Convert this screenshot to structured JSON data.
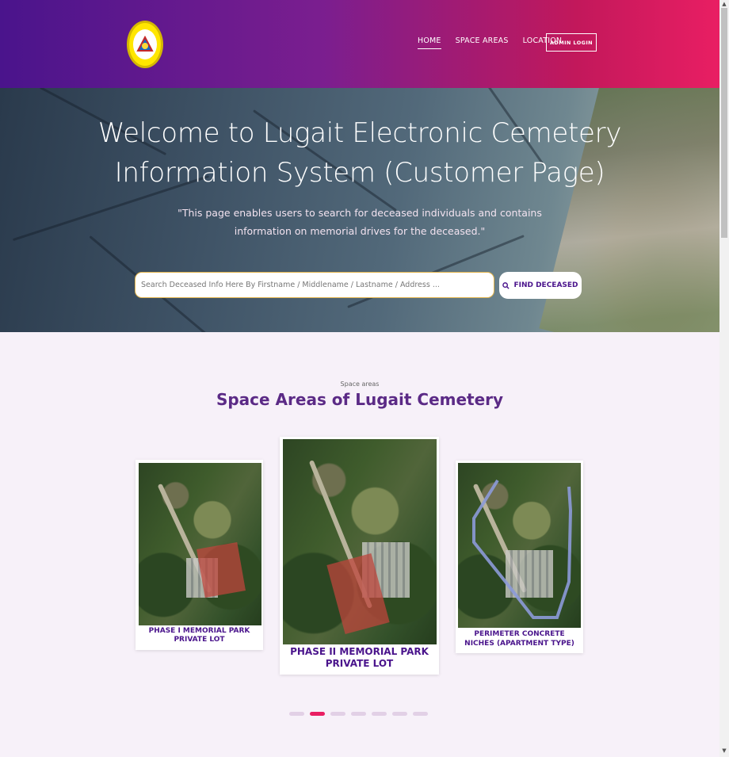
{
  "header": {
    "logo_name": "municipality-seal",
    "nav": [
      {
        "label": "HOME",
        "active": true
      },
      {
        "label": "SPACE AREAS",
        "active": false
      },
      {
        "label": "LOCATION",
        "active": false
      }
    ],
    "admin_button": "ADMIN LOGIN",
    "gradient": [
      "#4a148c",
      "#e91e63"
    ]
  },
  "hero": {
    "title_line1": "Welcome to Lugait Electronic Cemetery",
    "title_line2": "Information System (Customer Page)",
    "subtitle_line1": "\"This page enables users to search for deceased individuals and contains",
    "subtitle_line2": "information on memorial drives for the deceased.\"",
    "search_placeholder": "Search Deceased Info Here By Firstname / Middlename / Lastname / Address ...",
    "find_button": "FIND DECEASED"
  },
  "space_areas": {
    "eyebrow": "Space areas",
    "title": "Space Areas of Lugait Cemetery",
    "cards": [
      {
        "caption": "PHASE I MEMORIAL PARK PRIVATE LOT"
      },
      {
        "caption": "PHASE II MEMORIAL PARK PRIVATE LOT"
      },
      {
        "caption": "PERIMETER CONCRETE NICHES (APARTMENT TYPE)"
      }
    ],
    "pagination_count": 7,
    "active_page": 2
  },
  "colors": {
    "accent": "#5b2a86",
    "active_dot": "#e91e63"
  }
}
